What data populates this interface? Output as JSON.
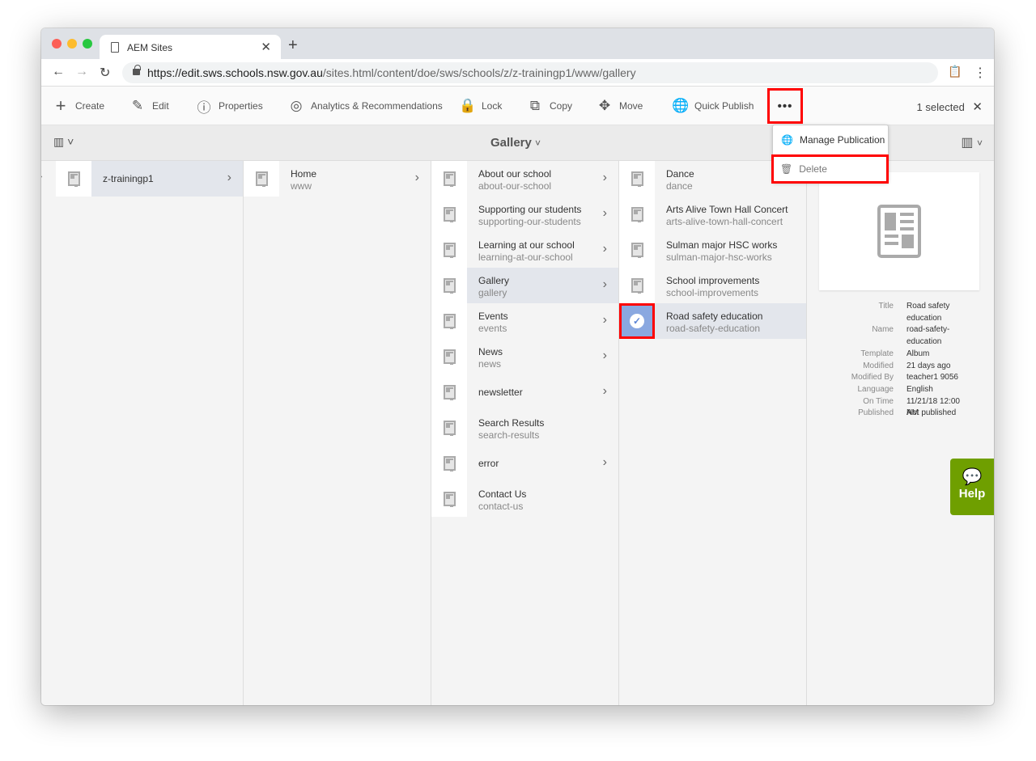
{
  "browser": {
    "tab_title": "AEM Sites",
    "url_host": "https://edit.sws.schools.nsw.gov.au",
    "url_path": "/sites.html/content/doe/sws/schools/z/z-trainingp1/www/gallery"
  },
  "toolbar": {
    "create": "Create",
    "edit": "Edit",
    "properties": "Properties",
    "analytics": "Analytics & Recommendations",
    "lock": "Lock",
    "copy": "Copy",
    "move": "Move",
    "quick_publish": "Quick Publish",
    "more": "•••",
    "selected": "1 selected"
  },
  "subheader": {
    "title": "Gallery"
  },
  "more_menu": [
    {
      "label": "Manage Publication",
      "icon": "globe-clock-icon"
    },
    {
      "label": "Delete",
      "icon": "trash-icon"
    }
  ],
  "columns": [
    [
      {
        "title": "z-trainingp1",
        "sub": "",
        "chevron": true,
        "active": true
      }
    ],
    [
      {
        "title": "Home",
        "sub": "www",
        "chevron": true,
        "active": false
      }
    ],
    [
      {
        "title": "About our school",
        "sub": "about-our-school",
        "chevron": true
      },
      {
        "title": "Supporting our students",
        "sub": "supporting-our-students",
        "chevron": true
      },
      {
        "title": "Learning at our school",
        "sub": "learning-at-our-school",
        "chevron": true
      },
      {
        "title": "Gallery",
        "sub": "gallery",
        "chevron": true,
        "active": true
      },
      {
        "title": "Events",
        "sub": "events",
        "chevron": true
      },
      {
        "title": "News",
        "sub": "news",
        "chevron": true
      },
      {
        "title": "newsletter",
        "sub": "",
        "chevron": true
      },
      {
        "title": "Search Results",
        "sub": "search-results",
        "chevron": false
      },
      {
        "title": "error",
        "sub": "",
        "chevron": true
      },
      {
        "title": "Contact Us",
        "sub": "contact-us",
        "chevron": false
      }
    ],
    [
      {
        "title": "Dance",
        "sub": "dance"
      },
      {
        "title": "Arts Alive Town Hall Concert",
        "sub": "arts-alive-town-hall-concert"
      },
      {
        "title": "Sulman major HSC works",
        "sub": "sulman-major-hsc-works"
      },
      {
        "title": "School improvements",
        "sub": "school-improvements"
      },
      {
        "title": "Road safety education",
        "sub": "road-safety-education",
        "active": true,
        "selected": true
      }
    ]
  ],
  "details": [
    {
      "k": "Title",
      "v": "Road safety education",
      "lines": 2
    },
    {
      "k": "Name",
      "v": "road-safety-education",
      "lines": 2
    },
    {
      "k": "Template",
      "v": "Album",
      "lines": 1
    },
    {
      "k": "Modified",
      "v": "21 days ago",
      "lines": 1
    },
    {
      "k": "Modified By",
      "v": "teacher1 9056",
      "lines": 1
    },
    {
      "k": "Language",
      "v": "English",
      "lines": 1
    },
    {
      "k": "On Time",
      "v": "11/21/18 12:00 AM",
      "lines": 1
    },
    {
      "k": "Published",
      "v": "Not published",
      "lines": 1
    }
  ],
  "help": {
    "label": "Help",
    "color": "#6f9f00"
  }
}
